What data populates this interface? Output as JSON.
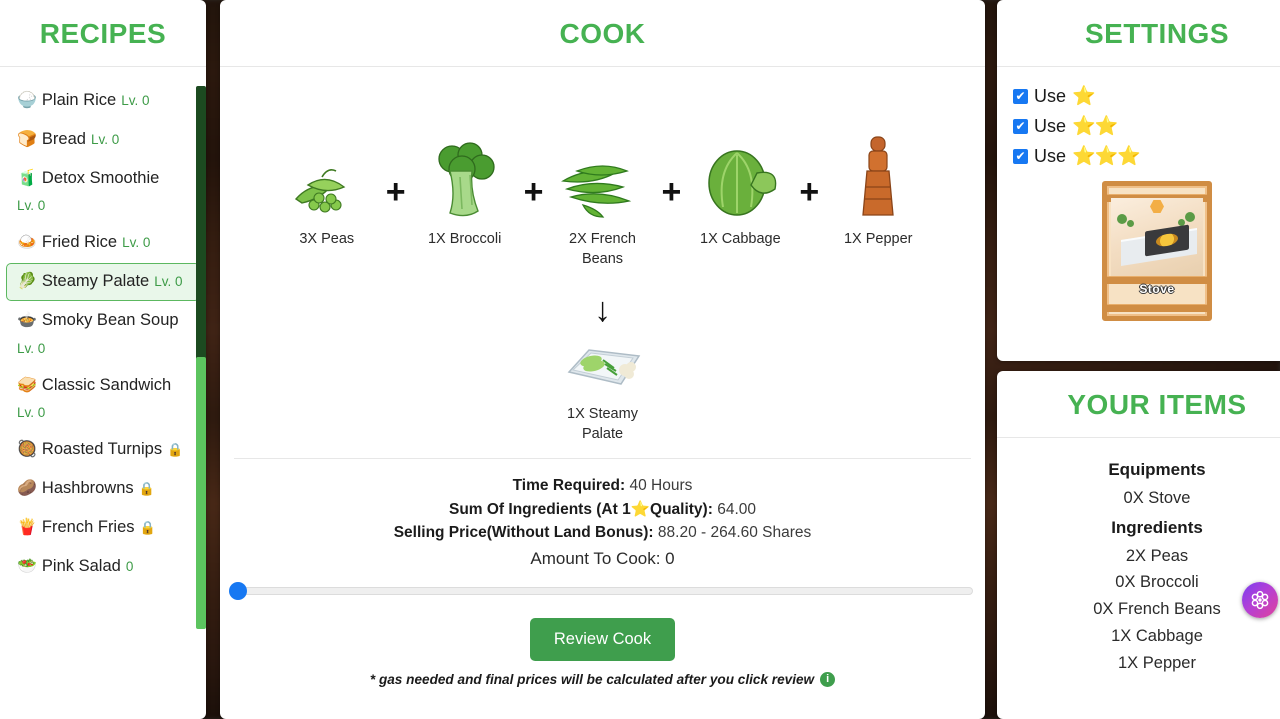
{
  "theme": {
    "accent_green": "#46b252",
    "button_green": "#3f9e4d",
    "checkbox_blue": "#1778f2",
    "slider_blue": "#1778f2"
  },
  "recipes_panel": {
    "title": "RECIPES",
    "items": [
      {
        "emoji": "🍚",
        "name": "Plain Rice",
        "level": "Lv. 0",
        "locked": false,
        "selected": false
      },
      {
        "emoji": "🍞",
        "name": "Bread",
        "level": "Lv. 0",
        "locked": false,
        "selected": false
      },
      {
        "emoji": "🧃",
        "name": "Detox Smoothie",
        "level": "Lv. 0",
        "locked": false,
        "selected": false
      },
      {
        "emoji": "🍛",
        "name": "Fried Rice",
        "level": "Lv. 0",
        "locked": false,
        "selected": false
      },
      {
        "emoji": "🥬",
        "name": "Steamy Palate",
        "level": "Lv. 0",
        "locked": false,
        "selected": true
      },
      {
        "emoji": "🍲",
        "name": "Smoky Bean Soup",
        "level": "Lv. 0",
        "locked": false,
        "selected": false
      },
      {
        "emoji": "🥪",
        "name": "Classic Sandwich",
        "level": "Lv. 0",
        "locked": false,
        "selected": false
      },
      {
        "emoji": "🥘",
        "name": "Roasted Turnips",
        "level": "",
        "locked": true,
        "lock": "🔒",
        "selected": false
      },
      {
        "emoji": "🥔",
        "name": "Hashbrowns",
        "level": "",
        "locked": true,
        "lock": "🔒",
        "selected": false
      },
      {
        "emoji": "🍟",
        "name": "French Fries",
        "level": "",
        "locked": true,
        "lock": "🔒",
        "selected": false
      },
      {
        "emoji": "🥗",
        "name": "Pink Salad",
        "level": "0",
        "locked": true,
        "lock": "",
        "selected": false
      }
    ]
  },
  "cook_panel": {
    "title": "COOK",
    "ingredients": [
      {
        "label": "3X Peas",
        "icon": "peas-icon"
      },
      {
        "label": "1X Broccoli",
        "icon": "broccoli-icon"
      },
      {
        "label": "2X French Beans",
        "icon": "french-beans-icon"
      },
      {
        "label": "1X Cabbage",
        "icon": "cabbage-icon"
      },
      {
        "label": "1X Pepper",
        "icon": "pepper-grinder-icon"
      }
    ],
    "plus_symbol": "+",
    "arrow_symbol": "↓",
    "result": {
      "label": "1X Steamy Palate",
      "icon": "steamy-palate-icon"
    },
    "stats": {
      "time_label": "Time Required:",
      "time_value": "40 Hours",
      "sum_label_a": "Sum Of Ingredients (At 1",
      "sum_star": "⭐",
      "sum_label_b": "Quality):",
      "sum_value": "64.00",
      "price_label": "Selling Price(Without Land Bonus):",
      "price_value": "88.20 - 264.60 Shares",
      "amount_text": "Amount To Cook: 0"
    },
    "slider": {
      "value": 0,
      "min": 0,
      "max": 100
    },
    "review_button": "Review Cook",
    "note": "* gas needed and final prices will be calculated after you click review",
    "note_info_icon": "i"
  },
  "settings_panel": {
    "title": "SETTINGS",
    "options": [
      {
        "label": "Use",
        "stars": "⭐",
        "checked": true,
        "check_mark": "✔"
      },
      {
        "label": "Use",
        "stars": "⭐⭐",
        "checked": true,
        "check_mark": "✔"
      },
      {
        "label": "Use",
        "stars": "⭐⭐⭐",
        "checked": true,
        "check_mark": "✔"
      }
    ],
    "equipment_card": {
      "label": "Stove"
    }
  },
  "items_panel": {
    "title": "YOUR ITEMS",
    "equipments_heading": "Equipments",
    "equipments": [
      "0X Stove"
    ],
    "ingredients_heading": "Ingredients",
    "ingredients": [
      "2X Peas",
      "0X Broccoli",
      "0X French Beans",
      "1X Cabbage",
      "1X Pepper"
    ]
  },
  "floating_badge": {
    "icon": "flower-badge-icon"
  }
}
